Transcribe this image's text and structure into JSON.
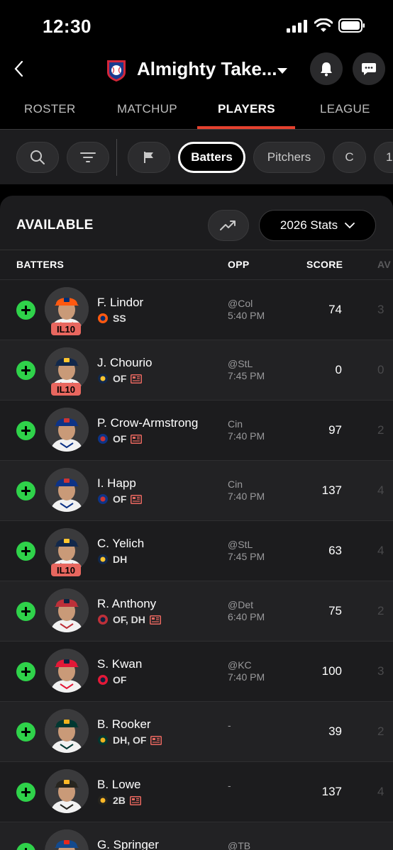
{
  "status": {
    "time": "12:30"
  },
  "header": {
    "team_name": "Almighty Take..."
  },
  "tabs": [
    {
      "label": "ROSTER"
    },
    {
      "label": "MATCHUP"
    },
    {
      "label": "PLAYERS"
    },
    {
      "label": "LEAGUE"
    }
  ],
  "filters": {
    "chips": [
      "Batters",
      "Pitchers",
      "C",
      "1"
    ],
    "selected": "Batters"
  },
  "section": {
    "title": "AVAILABLE",
    "stats_select": "2026 Stats"
  },
  "columns": {
    "batters": "BATTERS",
    "opp": "OPP",
    "score": "SCORE",
    "avg": "AV"
  },
  "colors": {
    "accent": "#e4412f",
    "add": "#2fd24a",
    "il": "#e8675f"
  },
  "players": [
    {
      "name": "F. Lindor",
      "pos": "SS",
      "team_icon": "mets-logo",
      "news": false,
      "opp": "@Col",
      "time": "5:40 PM",
      "score": "74",
      "avg": "3",
      "il": "IL10"
    },
    {
      "name": "J. Chourio",
      "pos": "OF",
      "team_icon": "brewers-logo",
      "news": true,
      "opp": "@StL",
      "time": "7:45 PM",
      "score": "0",
      "avg": "0",
      "il": "IL10"
    },
    {
      "name": "P. Crow-Armstrong",
      "pos": "OF",
      "team_icon": "cubs-logo",
      "news": true,
      "opp": "Cin",
      "time": "7:40 PM",
      "score": "97",
      "avg": "2",
      "il": ""
    },
    {
      "name": "I. Happ",
      "pos": "OF",
      "team_icon": "cubs-logo",
      "news": true,
      "opp": "Cin",
      "time": "7:40 PM",
      "score": "137",
      "avg": "4",
      "il": ""
    },
    {
      "name": "C. Yelich",
      "pos": "DH",
      "team_icon": "brewers-logo",
      "news": false,
      "opp": "@StL",
      "time": "7:45 PM",
      "score": "63",
      "avg": "4",
      "il": "IL10"
    },
    {
      "name": "R. Anthony",
      "pos": "OF, DH",
      "team_icon": "red-sox-logo",
      "news": true,
      "opp": "@Det",
      "time": "6:40 PM",
      "score": "75",
      "avg": "2",
      "il": ""
    },
    {
      "name": "S. Kwan",
      "pos": "OF",
      "team_icon": "guardians-logo",
      "news": false,
      "opp": "@KC",
      "time": "7:40 PM",
      "score": "100",
      "avg": "3",
      "il": ""
    },
    {
      "name": "B. Rooker",
      "pos": "DH, OF",
      "team_icon": "athletics-logo",
      "news": true,
      "opp": "-",
      "time": "",
      "score": "39",
      "avg": "2",
      "il": ""
    },
    {
      "name": "B. Lowe",
      "pos": "2B",
      "team_icon": "pirates-logo",
      "news": true,
      "opp": "-",
      "time": "",
      "score": "137",
      "avg": "4",
      "il": ""
    },
    {
      "name": "G. Springer",
      "pos": "",
      "team_icon": "blue-jays-logo",
      "news": false,
      "opp": "@TB",
      "time": "",
      "score": "",
      "avg": "",
      "il": ""
    }
  ]
}
